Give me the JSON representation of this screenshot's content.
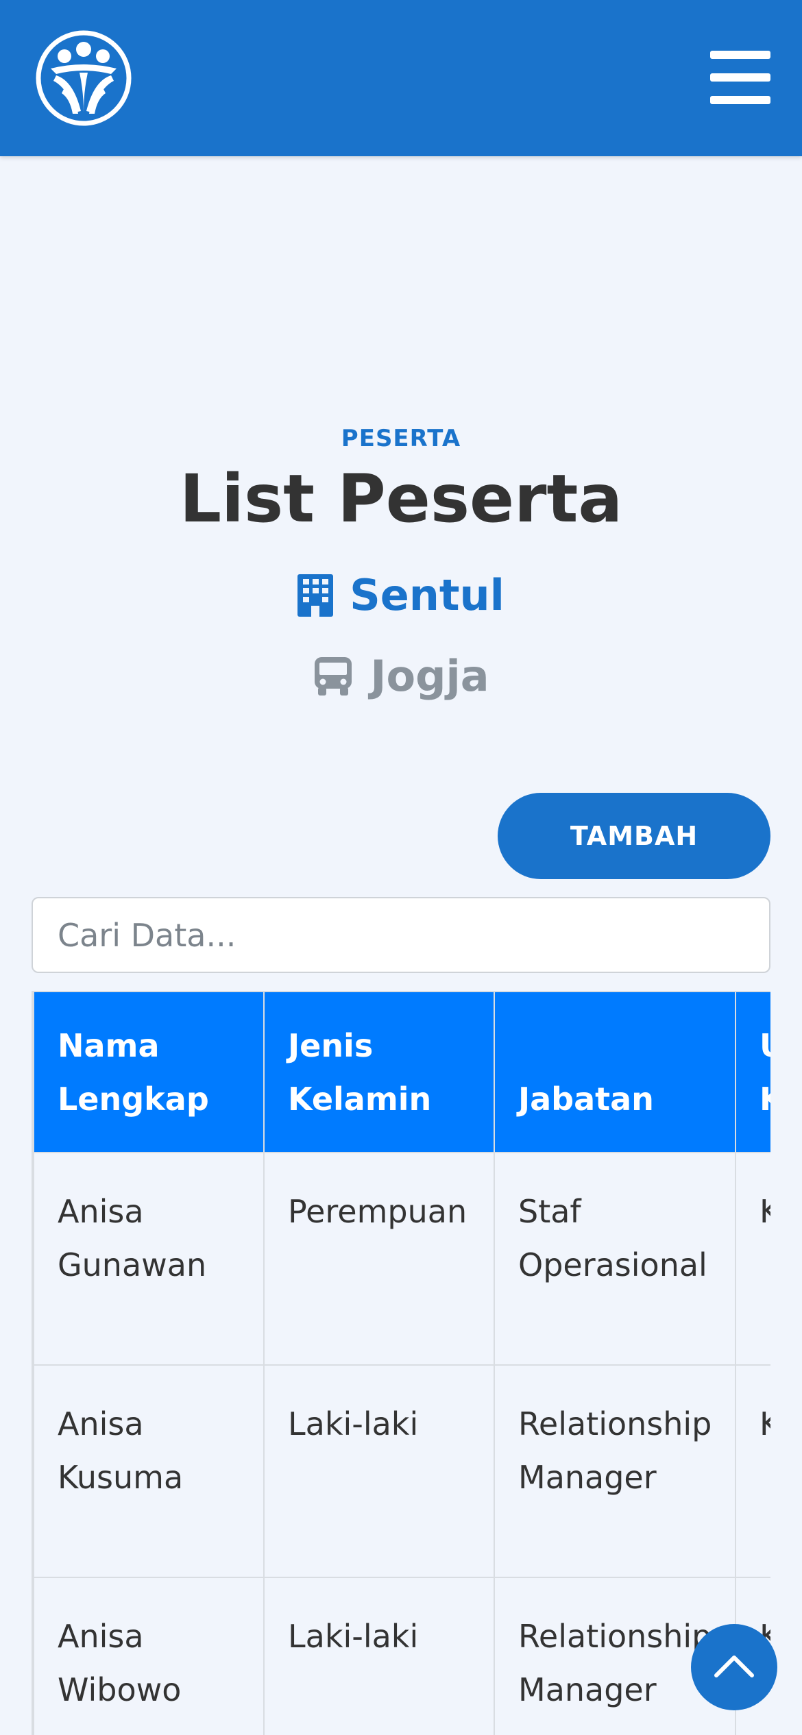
{
  "header": {
    "logo_icon": "community-logo-icon",
    "menu_icon": "hamburger-menu-icon",
    "brand_color": "#1a73cb"
  },
  "page": {
    "section_label": "PESERTA",
    "title": "List Peserta",
    "company": {
      "icon": "building-icon",
      "name": "Sentul"
    },
    "route": {
      "icon": "bus-icon",
      "name": "Jogja"
    }
  },
  "actions": {
    "add_label": "TAMBAH",
    "search_placeholder": "Cari Data..."
  },
  "table": {
    "headers": [
      "Nama Lengkap",
      "Jenis Kelamin",
      "Jabatan",
      "Unit Kerja"
    ],
    "header_color": "#007bff",
    "rows": [
      [
        "Anisa Gunawan",
        "Perempuan",
        "Staf Operasional",
        "K"
      ],
      [
        "Anisa Kusuma",
        "Laki-laki",
        "Relationship Manager",
        "K"
      ],
      [
        "Anisa Wibowo",
        "Laki-laki",
        "Relationship Manager",
        "K"
      ]
    ]
  },
  "scroll_top": {
    "icon": "chevron-up-icon"
  }
}
